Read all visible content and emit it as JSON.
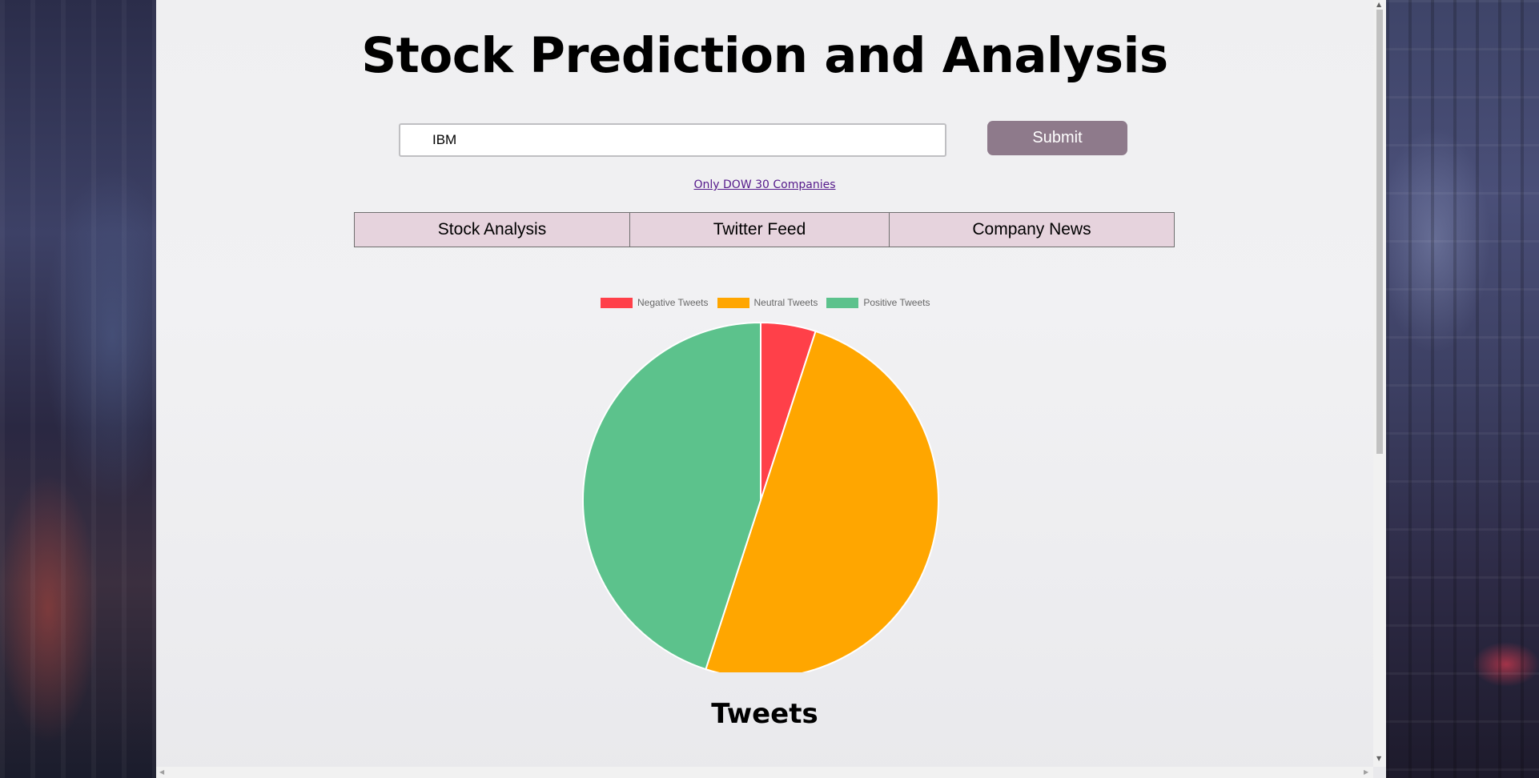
{
  "header": {
    "title": "Stock Prediction and Analysis"
  },
  "search": {
    "value": "IBM",
    "submit_label": "Submit"
  },
  "links": {
    "dow": "Only DOW 30 Companies"
  },
  "tabs": [
    {
      "label": "Stock Analysis"
    },
    {
      "label": "Twitter Feed"
    },
    {
      "label": "Company News"
    }
  ],
  "chart_data": {
    "type": "pie",
    "title": "",
    "legend_position": "top",
    "categories": [
      "Negative Tweets",
      "Neutral Tweets",
      "Positive Tweets"
    ],
    "values": [
      5,
      50,
      45
    ],
    "colors": [
      "#ff4049",
      "#ffa600",
      "#5cc28c"
    ]
  },
  "sections": {
    "tweets_title": "Tweets"
  },
  "scrollbars": {
    "up": "▲",
    "down": "▼",
    "left": "◀",
    "right": "▶"
  }
}
